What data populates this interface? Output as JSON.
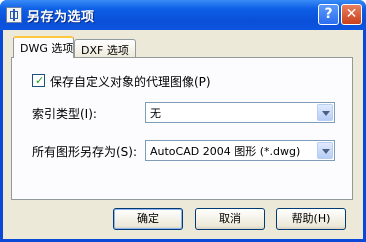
{
  "window": {
    "title": "另存为选项"
  },
  "tabs": [
    {
      "label": "DWG 选项",
      "active": true
    },
    {
      "label": "DXF 选项",
      "active": false
    }
  ],
  "dwg_options": {
    "save_proxy_images": {
      "label": "保存自定义对象的代理图像(P)",
      "checked": true
    },
    "index_type": {
      "label": "索引类型(I):",
      "value": "无"
    },
    "save_all_as": {
      "label": "所有图形另存为(S):",
      "value": "AutoCAD 2004 图形 (*.dwg)"
    }
  },
  "buttons": {
    "ok": "确定",
    "cancel": "取消",
    "help": "帮助(H)"
  },
  "titlebar_buttons": {
    "help": "?",
    "close": "✕"
  },
  "colors": {
    "title_bar": "#0a4fd8",
    "dialog_bg": "#ece9d8",
    "active_tab_accent": "#ffc83c",
    "checkmark": "#21a121"
  }
}
